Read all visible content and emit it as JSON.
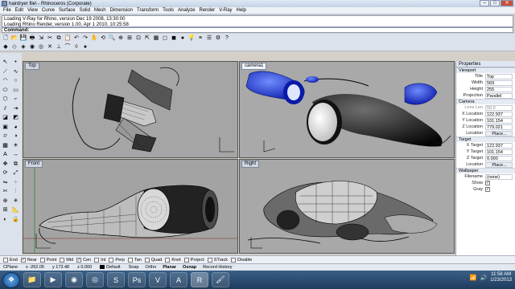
{
  "window": {
    "title": "hairdryer file\\ - Rhinoceros (Corporate)"
  },
  "menu": [
    "File",
    "Edit",
    "View",
    "Curve",
    "Surface",
    "Solid",
    "Mesh",
    "Dimension",
    "Transform",
    "Tools",
    "Analyze",
    "Render",
    "V-Ray",
    "Help"
  ],
  "command_history": [
    "Loading V-Ray for Rhino, version Dec 19 2008, 13:30:00",
    "Loading Rhino Render, version 1.00, Apr  1 2010, 10:25:58"
  ],
  "command_prompt": "Command:",
  "viewports": {
    "top": {
      "label": "Top"
    },
    "perspective": {
      "label": "camera1"
    },
    "front": {
      "label": "Front"
    },
    "right": {
      "label": "Right"
    }
  },
  "properties": {
    "title": "Properties",
    "section_viewport": "Viewport",
    "title_label": "Title",
    "title_value": "Top",
    "width_label": "Width",
    "width_value": "569",
    "height_label": "Height",
    "height_value": "255",
    "projection_label": "Projection",
    "projection_value": "Parallel",
    "section_camera": "Camera",
    "lens_label": "Lens Len",
    "lens_value": "50.0",
    "xloc_label": "X Location",
    "xloc_value": "122.937",
    "yloc_label": "Y Location",
    "yloc_value": "101.154",
    "zloc_label": "Z Location",
    "zloc_value": "779.021",
    "location_label": "Location",
    "place_label": "Place...",
    "section_target": "Target",
    "xtarget_label": "X Target",
    "xtarget_value": "122.937",
    "ytarget_label": "Y Target",
    "ytarget_value": "101.154",
    "ztarget_label": "Z Target",
    "ztarget_value": "0.000",
    "target_location_label": "Location",
    "target_place_label": "Place...",
    "section_wallpaper": "Wallpaper",
    "filename_label": "Filename",
    "filename_value": "(none)",
    "show_label": "Show",
    "gray_label": "Gray"
  },
  "osnaps": [
    {
      "label": "End",
      "checked": false
    },
    {
      "label": "Near",
      "checked": true
    },
    {
      "label": "Point",
      "checked": false
    },
    {
      "label": "Mid",
      "checked": false
    },
    {
      "label": "Cen",
      "checked": true
    },
    {
      "label": "Int",
      "checked": false
    },
    {
      "label": "Perp",
      "checked": false
    },
    {
      "label": "Tan",
      "checked": false
    },
    {
      "label": "Quad",
      "checked": false
    },
    {
      "label": "Knot",
      "checked": false
    },
    {
      "label": "Project",
      "checked": false
    },
    {
      "label": "STrack",
      "checked": false
    },
    {
      "label": "Disable",
      "checked": false
    }
  ],
  "status": {
    "cplane": "CPlane",
    "x": "x -262.05",
    "y": "y 173.48",
    "z": "z 0.000",
    "layer": "Default",
    "snap": "Snap",
    "ortho": "Ortho",
    "planar": "Planar",
    "osnap": "Osnap",
    "record_history": "Record History"
  },
  "taskbar": {
    "time": "11:58 AM",
    "date": "1/23/2013"
  }
}
